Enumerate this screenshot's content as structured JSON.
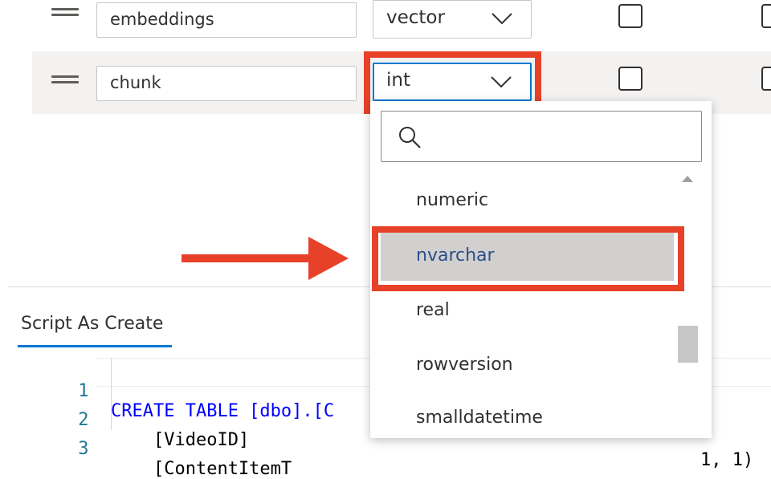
{
  "columns": [
    {
      "name": "embeddings",
      "type": "vector"
    },
    {
      "name": "chunk",
      "type": "int"
    }
  ],
  "dropdown": {
    "search_placeholder": "",
    "options": [
      "numeric",
      "nvarchar",
      "real",
      "rowversion",
      "smalldatetime"
    ],
    "highlighted": "nvarchar"
  },
  "script_tab": {
    "label": "Script As Create"
  },
  "code": {
    "lines": [
      {
        "number": "1",
        "text": "CREATE TABLE [dbo].[C"
      },
      {
        "number": "2",
        "text": "    [VideoID]",
        "tail": "1, 1)"
      },
      {
        "number": "3",
        "text": "    [ContentItemT"
      }
    ]
  },
  "colors": {
    "highlight_box": "#e8412a",
    "accent": "#0078d4",
    "selected_option_bg": "#d2d0ce"
  },
  "icons": [
    "drag-handle-icon",
    "chevron-down-icon",
    "search-icon",
    "scroll-up-arrow-icon",
    "arrow-right-icon"
  ]
}
